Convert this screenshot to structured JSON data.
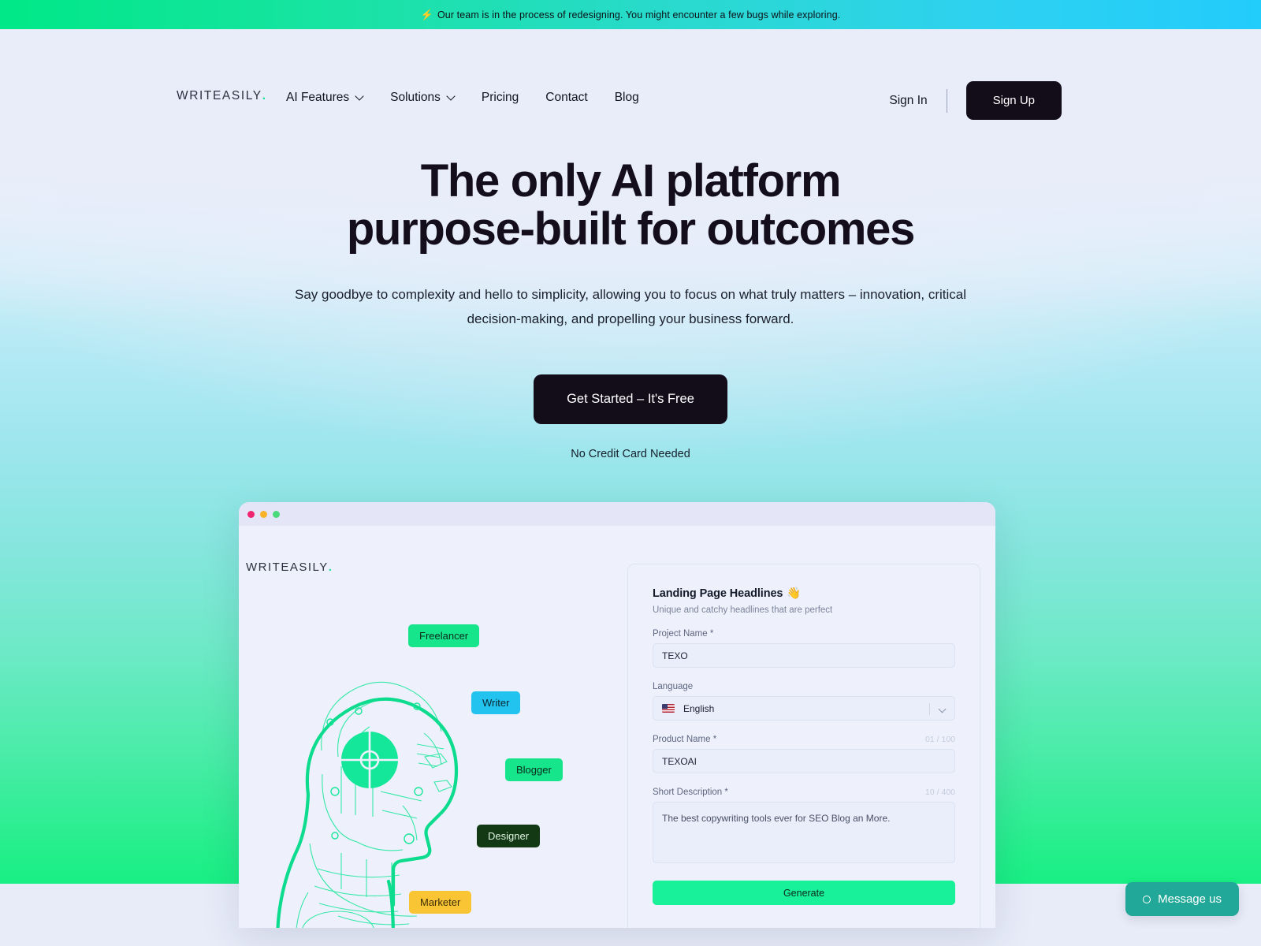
{
  "banner": {
    "icon": "sparkle-icon",
    "text": "Our team is in the process of redesigning. You might encounter a few bugs while exploring."
  },
  "nav": {
    "logo": "WRITEASILY",
    "logo_dot": ".",
    "items": [
      {
        "label": "AI Features",
        "has_caret": true
      },
      {
        "label": "Solutions",
        "has_caret": true
      },
      {
        "label": "Pricing",
        "has_caret": false
      },
      {
        "label": "Contact",
        "has_caret": false
      },
      {
        "label": "Blog",
        "has_caret": false
      }
    ],
    "sign_in": "Sign In",
    "sign_up": "Sign Up"
  },
  "hero": {
    "headline_line1": "The only AI platform",
    "headline_line2": "purpose-built for outcomes",
    "subtext": "Say goodbye to complexity and hello to simplicity, allowing you to focus on what truly matters – innovation, critical decision-making, and propelling your business forward.",
    "cta_label": "Get Started – It's Free",
    "note": "No Credit Card Needed"
  },
  "mockup": {
    "logo": "WRITEASILY",
    "logo_dot": ".",
    "pills": [
      {
        "label": "Freelancer",
        "color": "#16e58c"
      },
      {
        "label": "Writer",
        "color": "#23c3ef"
      },
      {
        "label": "Blogger",
        "color": "#16e58c"
      },
      {
        "label": "Designer",
        "color": "#123914"
      },
      {
        "label": "Marketer",
        "color": "#fac534"
      }
    ],
    "form": {
      "title": "Landing Page Headlines",
      "title_emoji": "👋",
      "subtitle": "Unique and catchy headlines that are perfect",
      "project_name_label": "Project Name *",
      "project_name_value": "TEXO",
      "language_label": "Language",
      "language_value": "English",
      "language_flag": "us-flag-icon",
      "product_name_label": "Product Name *",
      "product_name_counter": "01 / 100",
      "product_name_value": "TEXOAI",
      "short_description_label": "Short Description *",
      "short_description_counter": "10 / 400",
      "short_description_value": "The best copywriting tools ever for SEO Blog an More.",
      "generate_label": "Generate"
    }
  },
  "chat": {
    "label": "Message us",
    "icon": "chat-status-icon"
  },
  "colors": {
    "accent_green": "#19f09a",
    "accent_cyan": "#22ccfb",
    "dark": "#130d1a",
    "page_bg": "#e8ecf9",
    "chat_teal": "#21a898"
  }
}
